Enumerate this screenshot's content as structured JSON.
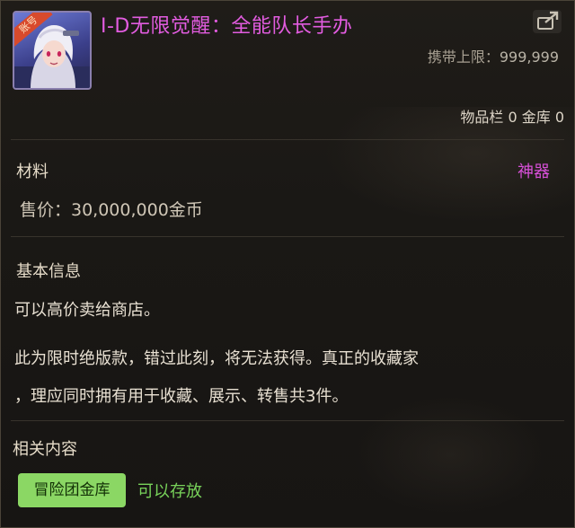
{
  "item": {
    "badge": "账号",
    "name": "I-D无限觉醒：全能队长手办",
    "carry_limit_label": "携带上限：",
    "carry_limit_value": "999,999",
    "storage": "物品栏 0 金库 0",
    "category": "材料",
    "grade": "神器",
    "price": "售价：30,000,000金币"
  },
  "basic_info": {
    "heading": "基本信息",
    "line1": "可以高价卖给商店。",
    "line2": "此为限时绝版款，错过此刻，将无法获得。真正的收藏家",
    "line3": "，理应同时拥有用于收藏、展示、转售共3件。"
  },
  "related": {
    "heading": "相关内容",
    "chip_label": "冒险团金库",
    "chip_status": "可以存放"
  },
  "colors": {
    "title": "#e25ce0",
    "grade": "#d750d8",
    "chip_bg": "#8bd764",
    "chip_status": "#78d25a"
  },
  "icons": {
    "item": "character-portrait-icon",
    "share": "share-export-icon"
  }
}
